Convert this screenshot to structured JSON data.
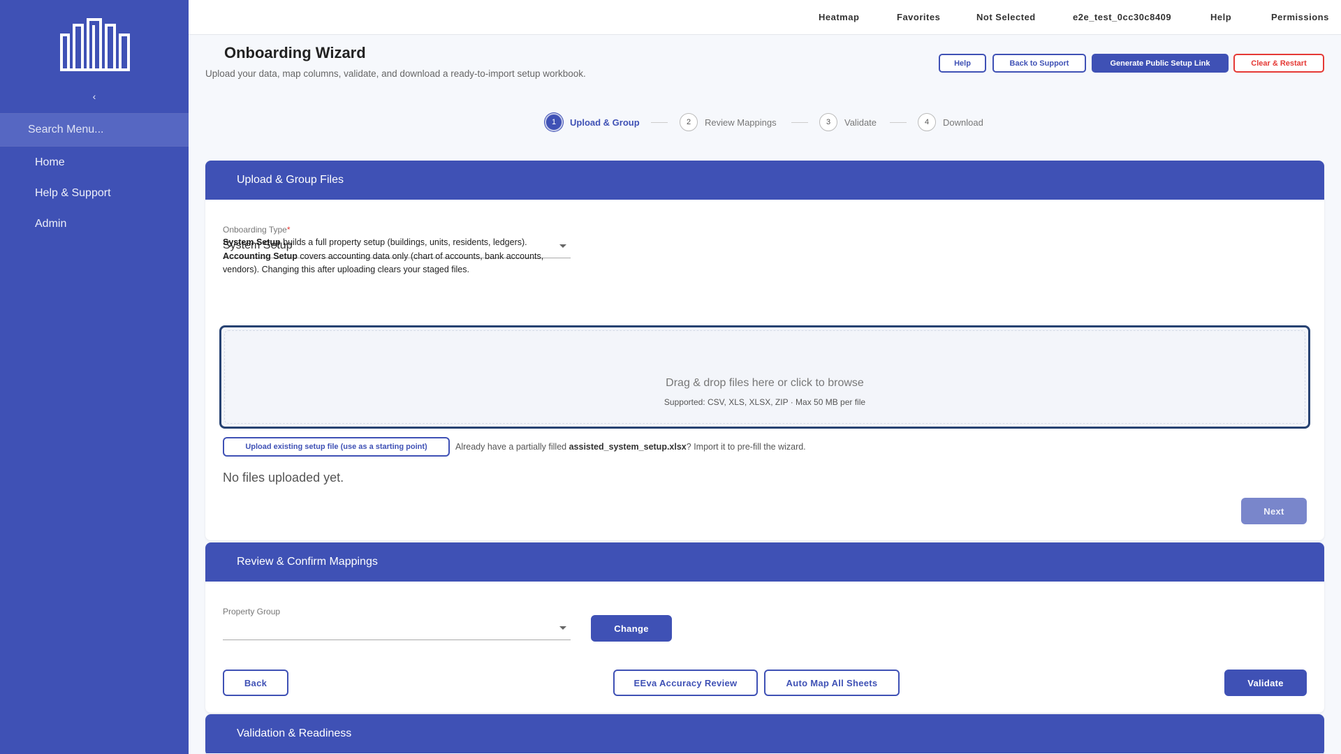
{
  "sidebar": {
    "collapse_glyph": "‹",
    "search_placeholder": "Search Menu...",
    "items": [
      {
        "label": "Home"
      },
      {
        "label": "Help & Support"
      },
      {
        "label": "Admin"
      }
    ]
  },
  "topbar": {
    "links": [
      "Heatmap",
      "Favorites",
      "Not Selected",
      "e2e_test_0cc30c8409",
      "Help",
      "Permissions"
    ]
  },
  "header": {
    "title": "Onboarding Wizard",
    "subtitle": "Upload your data, map columns, validate, and download a ready-to-import setup workbook.",
    "buttons": {
      "help": "Help",
      "back_to_support": "Back to Support",
      "generate_link": "Generate Public Setup Link",
      "clear_restart": "Clear & Restart"
    }
  },
  "stepper": {
    "steps": [
      {
        "number": "1",
        "label": "Upload & Group"
      },
      {
        "number": "2",
        "label": "Review Mappings"
      },
      {
        "number": "3",
        "label": "Validate"
      },
      {
        "number": "4",
        "label": "Download"
      }
    ],
    "active_step": 1
  },
  "upload_panel": {
    "title": "Upload & Group Files",
    "onboarding_type_label": "Onboarding Type",
    "required_marker": "*",
    "onboarding_type_value": "System Setup",
    "desc_system_title": "System Setup",
    "desc_system_text": " builds a full property setup (buildings, units, residents, ledgers).",
    "desc_accounting_title": "Accounting Setup",
    "desc_accounting_text": " covers accounting data only (chart of accounts, bank accounts, vendors). Changing this after uploading clears your staged files.",
    "dropzone_main": "Drag & drop files here or click to browse",
    "dropzone_sub": "Supported: CSV, XLS, XLSX, ZIP · Max 50 MB per file",
    "existing_button": "Upload existing setup file (use as a starting point)",
    "existing_note_pre": "Already have a partially filled ",
    "existing_note_file": "assisted_system_setup.xlsx",
    "existing_note_post": "? Import it to pre-fill the wizard.",
    "no_files": "No files uploaded yet.",
    "next_button": "Next"
  },
  "mapping_panel": {
    "title": "Review & Confirm Mappings",
    "property_group_label": "Property Group",
    "property_group_value": "",
    "change_button": "Change",
    "back_button": "Back",
    "accuracy_button": "EEva Accuracy Review",
    "automap_button": "Auto Map All Sheets",
    "validate_button": "Validate"
  },
  "validation_panel": {
    "title": "Validation & Readiness"
  },
  "colors": {
    "primary": "#3f51b5",
    "danger": "#e53935",
    "dropzone_border": "#274272"
  }
}
